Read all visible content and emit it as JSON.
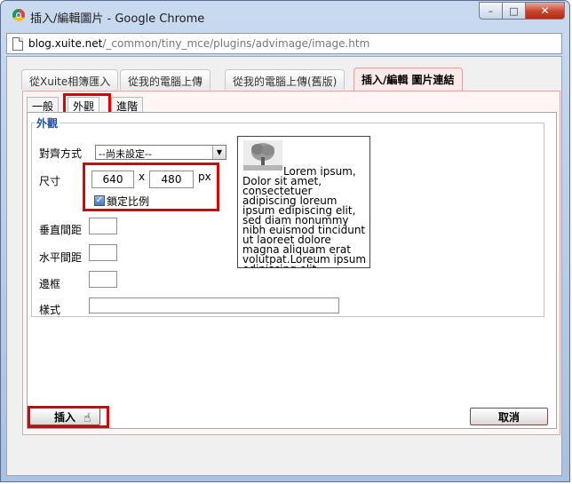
{
  "window": {
    "title": "插入/編輯圖片 - Google Chrome",
    "controls": {
      "minimize": "–",
      "maximize": "□",
      "close": "✕"
    }
  },
  "address": {
    "domain": "blog.xuite.net",
    "path": "/_common/tiny_mce/plugins/advimage/image.htm"
  },
  "top_tabs": [
    {
      "label": "從Xuite相簿匯入"
    },
    {
      "label": "從我的電腦上傳"
    },
    {
      "label": "從我的電腦上傳(舊版)"
    },
    {
      "label": "插入/編輯 圖片連結",
      "active": true
    }
  ],
  "inner_tabs": [
    {
      "label": "一般"
    },
    {
      "label": "外觀",
      "active": true
    },
    {
      "label": "進階"
    }
  ],
  "appearance": {
    "legend": "外觀",
    "align_label": "對齊方式",
    "align_value": "--尚未設定--",
    "size_label": "尺寸",
    "width": "640",
    "times": "x",
    "height": "480",
    "unit": "px",
    "constrain_label": "鎖定比例",
    "constrain_checked": true,
    "vspace_label": "垂直間距",
    "hspace_label": "水平間距",
    "border_label": "邊框",
    "style_label": "樣式",
    "vspace_value": "",
    "hspace_value": "",
    "border_value": "",
    "style_value": ""
  },
  "preview_text": "Lorem ipsum, Dolor sit amet, consectetuer adipiscing loreum ipsum edipiscing elit, sed diam nonummy nibh euismod tincidunt ut laoreet dolore magna aliquam erat volutpat.Loreum ipsum edipiscing elit,",
  "actions": {
    "insert": "插入",
    "cancel": "取消"
  },
  "colors": {
    "highlight": "#e20000",
    "legend": "#1f4fa6",
    "panel_border": "#e2a5a5"
  }
}
